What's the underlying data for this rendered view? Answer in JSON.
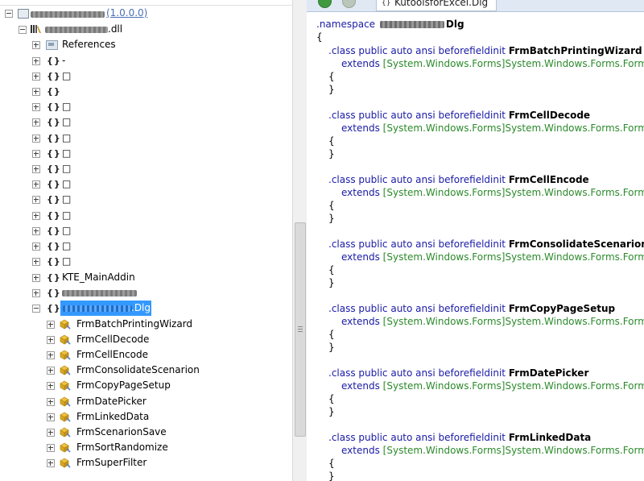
{
  "tree": {
    "root_label": "(1.0.0.0)",
    "dll_label": ".dll",
    "references_label": "References",
    "namespace_icon": "{}",
    "namespace_items": [
      "-",
      "□",
      "",
      "□",
      "□",
      "□",
      "□",
      "□",
      "□",
      "□",
      "□",
      "□",
      "□"
    ],
    "addin_label": "KTE_MainAddin",
    "dlg_namespace_label": ".Dlg",
    "classes": [
      "FrmBatchPrintingWizard",
      "FrmCellDecode",
      "FrmCellEncode",
      "FrmConsolidateScenarion",
      "FrmCopyPageSetup",
      "FrmDatePicker",
      "FrmLinkedData",
      "FrmScenarionSave",
      "FrmSortRandomize",
      "FrmSuperFilter"
    ]
  },
  "tab": {
    "label": "KutoolsforExcel.Dlg"
  },
  "code": {
    "namespace_keyword": ".namespace",
    "namespace_suffix": "Dlg",
    "open_brace": "{",
    "close_brace": "}",
    "class_decl": ".class public auto ansi beforefieldinit",
    "extends_keyword": "extends",
    "extends_type": "[System.Windows.Forms]System.Windows.Forms.Form",
    "classes": [
      "FrmBatchPrintingWizard",
      "FrmCellDecode",
      "FrmCellEncode",
      "FrmConsolidateScenarion",
      "FrmCopyPageSetup",
      "FrmDatePicker",
      "FrmLinkedData"
    ]
  },
  "colors": {
    "keyword": "#1a1aa6",
    "type": "#2b8a2b",
    "selection": "#3399ff"
  }
}
